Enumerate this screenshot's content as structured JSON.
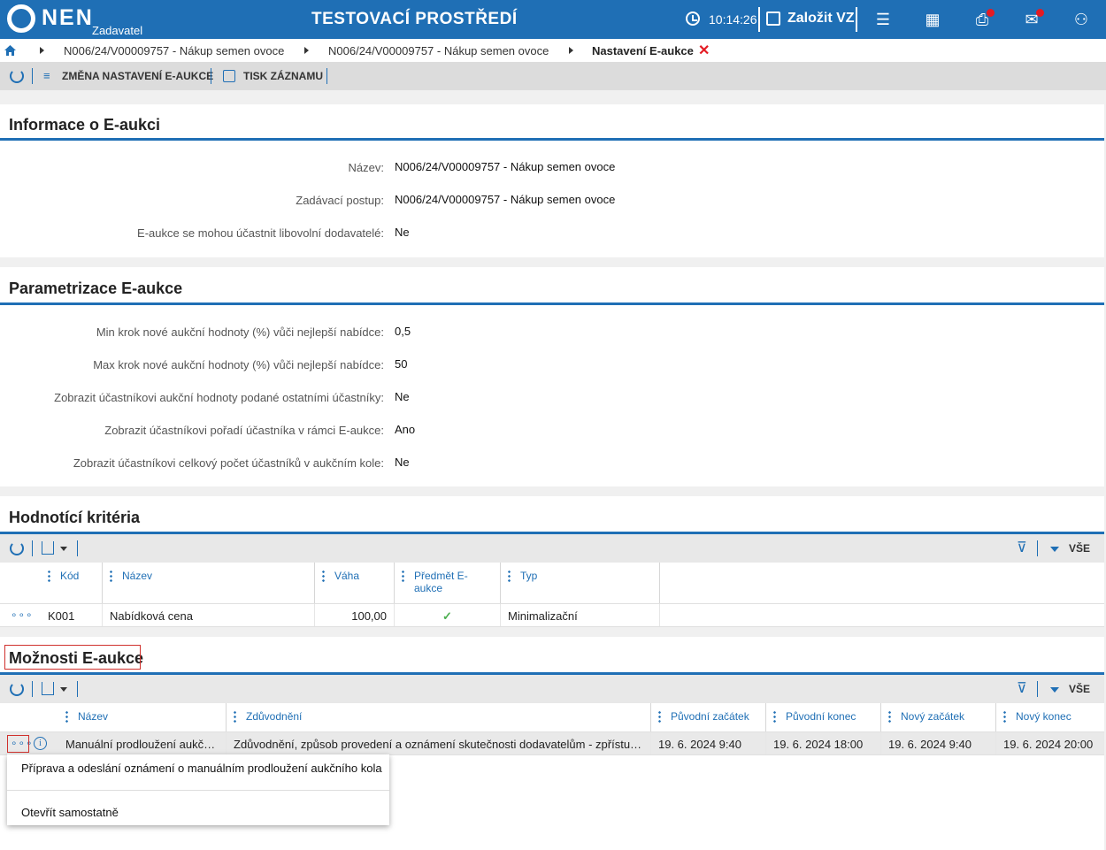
{
  "header": {
    "logo": "NEN",
    "logo_sub": "Zadavatel",
    "environment": "TESTOVACÍ PROSTŘEDÍ",
    "time": "10:14:26",
    "create_label": "Založit VZ"
  },
  "breadcrumb": {
    "items": [
      "N006/24/V00009757 - Nákup semen ovoce",
      "N006/24/V00009757 - Nákup semen ovoce"
    ],
    "current": "Nastavení E-aukce"
  },
  "toolbar": {
    "change_label": "ZMĚNA NASTAVENÍ E-AUKCE",
    "print_label": "TISK ZÁZNAMU"
  },
  "info_panel": {
    "title": "Informace o E-aukci",
    "fields": [
      {
        "label": "Název:",
        "value": "N006/24/V00009757 - Nákup semen ovoce"
      },
      {
        "label": "Zadávací postup:",
        "value": "N006/24/V00009757 - Nákup semen ovoce"
      },
      {
        "label": "E-aukce se mohou účastnit libovolní dodavatelé:",
        "value": "Ne"
      }
    ]
  },
  "param_panel": {
    "title": "Parametrizace E-aukce",
    "fields": [
      {
        "label": "Min krok nové aukční hodnoty (%) vůči nejlepší nabídce:",
        "value": "0,5"
      },
      {
        "label": "Max krok nové aukční hodnoty (%) vůči nejlepší nabídce:",
        "value": "50"
      },
      {
        "label": "Zobrazit účastníkovi aukční hodnoty podané ostatními účastníky:",
        "value": "Ne"
      },
      {
        "label": "Zobrazit účastníkovi pořadí účastníka v rámci E-aukce:",
        "value": "Ano"
      },
      {
        "label": "Zobrazit účastníkovi celkový počet účastníků v aukčním kole:",
        "value": "Ne"
      }
    ]
  },
  "criteria_panel": {
    "title": "Hodnotící kritéria",
    "all_label": "VŠE",
    "columns": [
      "Kód",
      "Název",
      "Váha",
      "Předmět E-aukce",
      "Typ"
    ],
    "rows": [
      {
        "menu": "∘∘∘",
        "code": "K001",
        "name": "Nabídková cena",
        "weight": "100,00",
        "subject": "✓",
        "type": "Minimalizační"
      }
    ]
  },
  "options_panel": {
    "title": "Možnosti E-aukce",
    "all_label": "VŠE",
    "columns": [
      "Název",
      "Zdůvodnění",
      "Původní začátek",
      "Původní konec",
      "Nový začátek",
      "Nový konec"
    ],
    "rows": [
      {
        "menu": "∘∘∘",
        "info": "i",
        "name": "Manuální prodloužení aukčn...",
        "reason": "Zdůvodnění, způsob provedení a oznámení skutečnosti dodavatelům - zpřístup...",
        "orig_start": "19. 6. 2024 9:40",
        "orig_end": "19. 6. 2024 18:00",
        "new_start": "19. 6. 2024 9:40",
        "new_end": "19. 6. 2024 20:00"
      }
    ]
  },
  "popup": {
    "items": [
      "Příprava a odeslání oznámení o manuálním prodloužení aukčního kola",
      "Otevřít samostatně"
    ]
  }
}
